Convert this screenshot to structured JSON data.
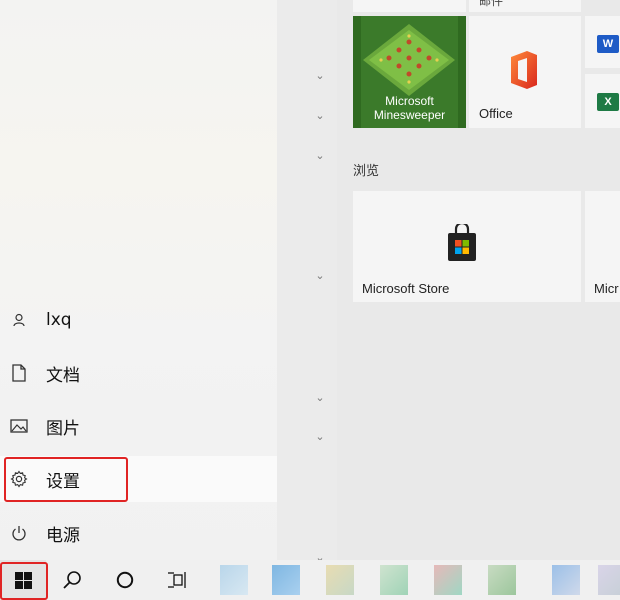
{
  "left": {
    "items": [
      {
        "label": "lxq",
        "icon": "user-icon"
      },
      {
        "label": "文档",
        "icon": "document-icon"
      },
      {
        "label": "图片",
        "icon": "picture-icon"
      },
      {
        "label": "设置",
        "icon": "gear-icon"
      },
      {
        "label": "电源",
        "icon": "power-icon"
      }
    ]
  },
  "tiles": {
    "top_partial_label": "邮件",
    "minesweeper_label_1": "Microsoft",
    "minesweeper_label_2": "Minesweeper",
    "office_label": "Office",
    "section_title": "浏览",
    "store_label": "Microsoft Store",
    "partial_right_label": "Micr"
  },
  "taskbar": {
    "start": "windows-icon",
    "search": "search-icon",
    "cortana": "cortana-icon",
    "task_view": "task-view-icon"
  },
  "colors": {
    "highlight_red": "#e02424",
    "minesweeper_green": "#3f7f2c",
    "word_blue": "#1e5bc6",
    "excel_green": "#1e7a45"
  }
}
